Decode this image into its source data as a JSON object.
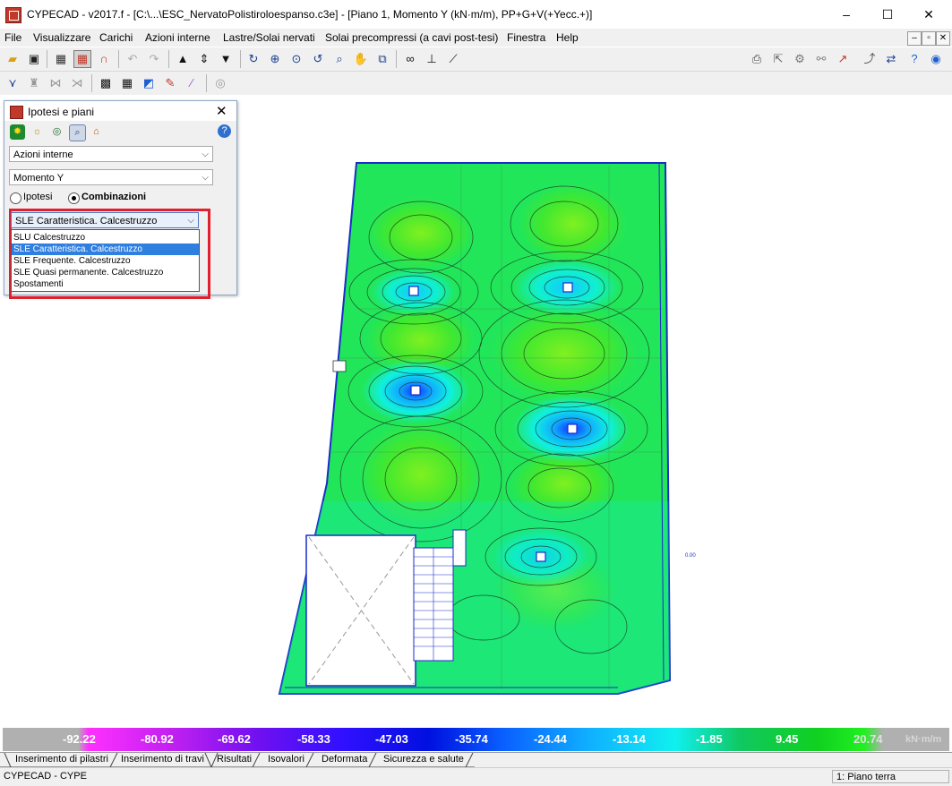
{
  "window": {
    "title": "CYPECAD - v2017.f - [C:\\...\\ESC_NervatoPolistiroloespanso.c3e] - [Piano 1, Momento Y (kN·m/m), PP+G+V(+Yecc.+)]",
    "minimize": "–",
    "maximize": "☐",
    "close": "✕"
  },
  "menu": {
    "items": [
      "File",
      "Visualizzare",
      "Carichi",
      "Azioni interne",
      "Lastre/Solai nervati",
      "Solai precompressi (a cavi post-tesi)",
      "Finestra",
      "Help"
    ],
    "mdi_min": "–",
    "mdi_restore": "▫",
    "mdi_close": "✕"
  },
  "panel": {
    "title": "Ipotesi e piani",
    "close": "✕",
    "help": "?",
    "combo1": "Azioni interne",
    "combo2": "Momento Y",
    "radio_ipotesi": "Ipotesi",
    "radio_combinazioni": "Combinazioni",
    "combo3": "SLE Caratteristica. Calcestruzzo",
    "dropdown": [
      "SLU Calcestruzzo",
      "SLE Caratteristica. Calcestruzzo",
      "SLE Frequente. Calcestruzzo",
      "SLE Quasi permanente. Calcestruzzo",
      "Spostamenti"
    ],
    "selected_index": 1
  },
  "canvas": {
    "small_label": "0.00"
  },
  "legend": {
    "values": [
      "-92.22",
      "-80.92",
      "-69.62",
      "-58.33",
      "-47.03",
      "-35.74",
      "-24.44",
      "-13.14",
      "-1.85",
      "9.45",
      "20.74"
    ],
    "unit": "kN·m/m",
    "colors": [
      "#ff30ff",
      "#b018e8",
      "#7a10f0",
      "#3010ff",
      "#0010e0",
      "#0a60ff",
      "#10b0ff",
      "#10f0f0",
      "#10c860",
      "#10d020",
      "#20f020"
    ]
  },
  "tabs": [
    "Inserimento di pilastri",
    "Inserimento di travi",
    "Risultati",
    "Isovalori",
    "Deformata",
    "Sicurezza e salute"
  ],
  "status": {
    "left": "CYPECAD - CYPE",
    "right": "1: Piano terra"
  }
}
